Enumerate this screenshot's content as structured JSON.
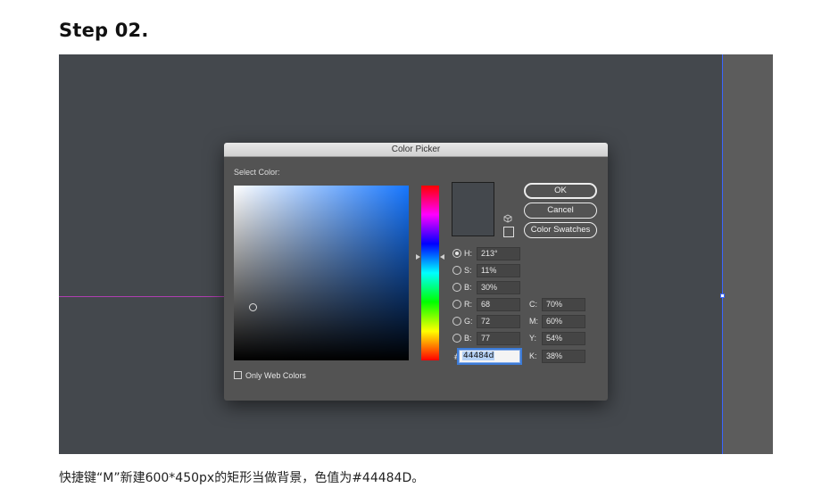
{
  "step_title": "Step 02.",
  "dialog": {
    "title": "Color Picker",
    "select_label": "Select Color:",
    "buttons": {
      "ok": "OK",
      "cancel": "Cancel",
      "swatches": "Color Swatches"
    },
    "hsb": [
      {
        "label": "H:",
        "value": "213°",
        "selected": true
      },
      {
        "label": "S:",
        "value": "11%",
        "selected": false
      },
      {
        "label": "B:",
        "value": "30%",
        "selected": false
      }
    ],
    "rgb": [
      {
        "label": "R:",
        "value": "68"
      },
      {
        "label": "G:",
        "value": "72"
      },
      {
        "label": "B:",
        "value": "77"
      }
    ],
    "cmyk": [
      {
        "label": "C:",
        "value": "70%"
      },
      {
        "label": "M:",
        "value": "60%"
      },
      {
        "label": "Y:",
        "value": "54%"
      },
      {
        "label": "K:",
        "value": "38%"
      }
    ],
    "hex_symbol": "#",
    "hex": "44484d",
    "only_web_colors": "Only Web Colors",
    "colors": {
      "current": "#44484d",
      "hue_field_base": "#1676ff"
    },
    "icons": {
      "cube": "cube-icon",
      "websafe": "websafe-swatch-icon"
    }
  },
  "colors": {
    "canvas": "#44484d",
    "guide_vertical": "#3a66ff",
    "guide_horizontal": "#b03fb0"
  },
  "caption": "快捷键“M”新建600*450px的矩形当做背景，色值为#44484D。"
}
